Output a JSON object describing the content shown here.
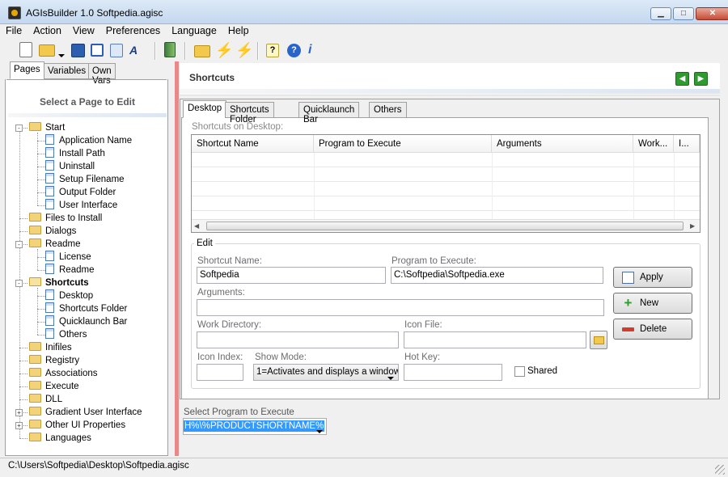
{
  "window": {
    "title": "AGIsBuilder 1.0 Softpedia.agisc",
    "minimize": "▁",
    "maximize": "□",
    "close": "✕"
  },
  "menu": [
    "File",
    "Action",
    "View",
    "Preferences",
    "Language",
    "Help"
  ],
  "toolbar_icons": [
    "new-icon",
    "open-icon",
    "save-icon",
    "save-as-icon",
    "preview-icon",
    "font-icon",
    "build-icon",
    "open-folder-icon",
    "compile-icon",
    "compile-run-icon",
    "help-icon",
    "about-icon",
    "info-icon"
  ],
  "left_tabs": [
    "Pages",
    "Variables",
    "Own Vars"
  ],
  "left_heading": "Select a Page to Edit",
  "tree": [
    {
      "label": "Start",
      "type": "folder",
      "level": 0,
      "toggle": "-"
    },
    {
      "label": "Application Name",
      "type": "doc",
      "level": 1
    },
    {
      "label": "Install Path",
      "type": "doc",
      "level": 1
    },
    {
      "label": "Uninstall",
      "type": "doc",
      "level": 1
    },
    {
      "label": "Setup Filename",
      "type": "doc",
      "level": 1
    },
    {
      "label": "Output Folder",
      "type": "doc",
      "level": 1
    },
    {
      "label": "User Interface",
      "type": "doc",
      "level": 1
    },
    {
      "label": "Files to Install",
      "type": "folder",
      "level": 0
    },
    {
      "label": "Dialogs",
      "type": "folder",
      "level": 0
    },
    {
      "label": "Readme",
      "type": "folder",
      "level": 0,
      "toggle": "-"
    },
    {
      "label": "License",
      "type": "doc",
      "level": 1
    },
    {
      "label": "Readme",
      "type": "doc",
      "level": 1
    },
    {
      "label": "Shortcuts",
      "type": "folder-open",
      "level": 0,
      "toggle": "-",
      "selected": true
    },
    {
      "label": "Desktop",
      "type": "doc",
      "level": 1
    },
    {
      "label": "Shortcuts Folder",
      "type": "doc",
      "level": 1
    },
    {
      "label": "Quicklaunch Bar",
      "type": "doc",
      "level": 1
    },
    {
      "label": "Others",
      "type": "doc",
      "level": 1
    },
    {
      "label": "Inifiles",
      "type": "folder",
      "level": 0
    },
    {
      "label": "Registry",
      "type": "folder",
      "level": 0
    },
    {
      "label": "Associations",
      "type": "folder",
      "level": 0
    },
    {
      "label": "Execute",
      "type": "folder",
      "level": 0
    },
    {
      "label": "DLL",
      "type": "folder",
      "level": 0
    },
    {
      "label": "Gradient User Interface",
      "type": "folder",
      "level": 0,
      "toggle": "+"
    },
    {
      "label": "Other UI Properties",
      "type": "folder",
      "level": 0,
      "toggle": "+"
    },
    {
      "label": "Languages",
      "type": "folder",
      "level": 0
    }
  ],
  "page_title": "Shortcuts",
  "nav": {
    "back": "◀",
    "forward": "▶"
  },
  "right_tabs": [
    "Desktop",
    "Shortcuts Folder",
    "Quicklaunch Bar",
    "Others"
  ],
  "grid": {
    "caption": "Shortcuts on Desktop:",
    "columns": [
      "Shortcut Name",
      "Program to Execute",
      "Arguments",
      "Work...",
      "I..."
    ],
    "rows": []
  },
  "edit": {
    "legend": "Edit",
    "shortcut_name_label": "Shortcut Name:",
    "shortcut_name_value": "Softpedia",
    "program_label": "Program to Execute:",
    "program_value": "C:\\Softpedia\\Softpedia.exe",
    "arguments_label": "Arguments:",
    "arguments_value": "",
    "workdir_label": "Work Directory:",
    "workdir_value": "",
    "iconfile_label": "Icon File:",
    "iconfile_value": "",
    "iconindex_label": "Icon Index:",
    "iconindex_value": "",
    "showmode_label": "Show Mode:",
    "showmode_value": "1=Activates and displays a window",
    "hotkey_label": "Hot Key:",
    "hotkey_value": "",
    "shared_label": "Shared",
    "shared_checked": false,
    "apply": "Apply",
    "new": "New",
    "delete": "Delete"
  },
  "select_program": {
    "label": "Select Program to Execute",
    "value": "H%\\%PRODUCTSHORTNAME%"
  },
  "status": {
    "path": "C:\\Users\\Softpedia\\Desktop\\Softpedia.agisc"
  },
  "colors": {
    "accent_bar": "#e7888a",
    "selection": "#3399ff",
    "nav_green": "#2f9a2f"
  }
}
